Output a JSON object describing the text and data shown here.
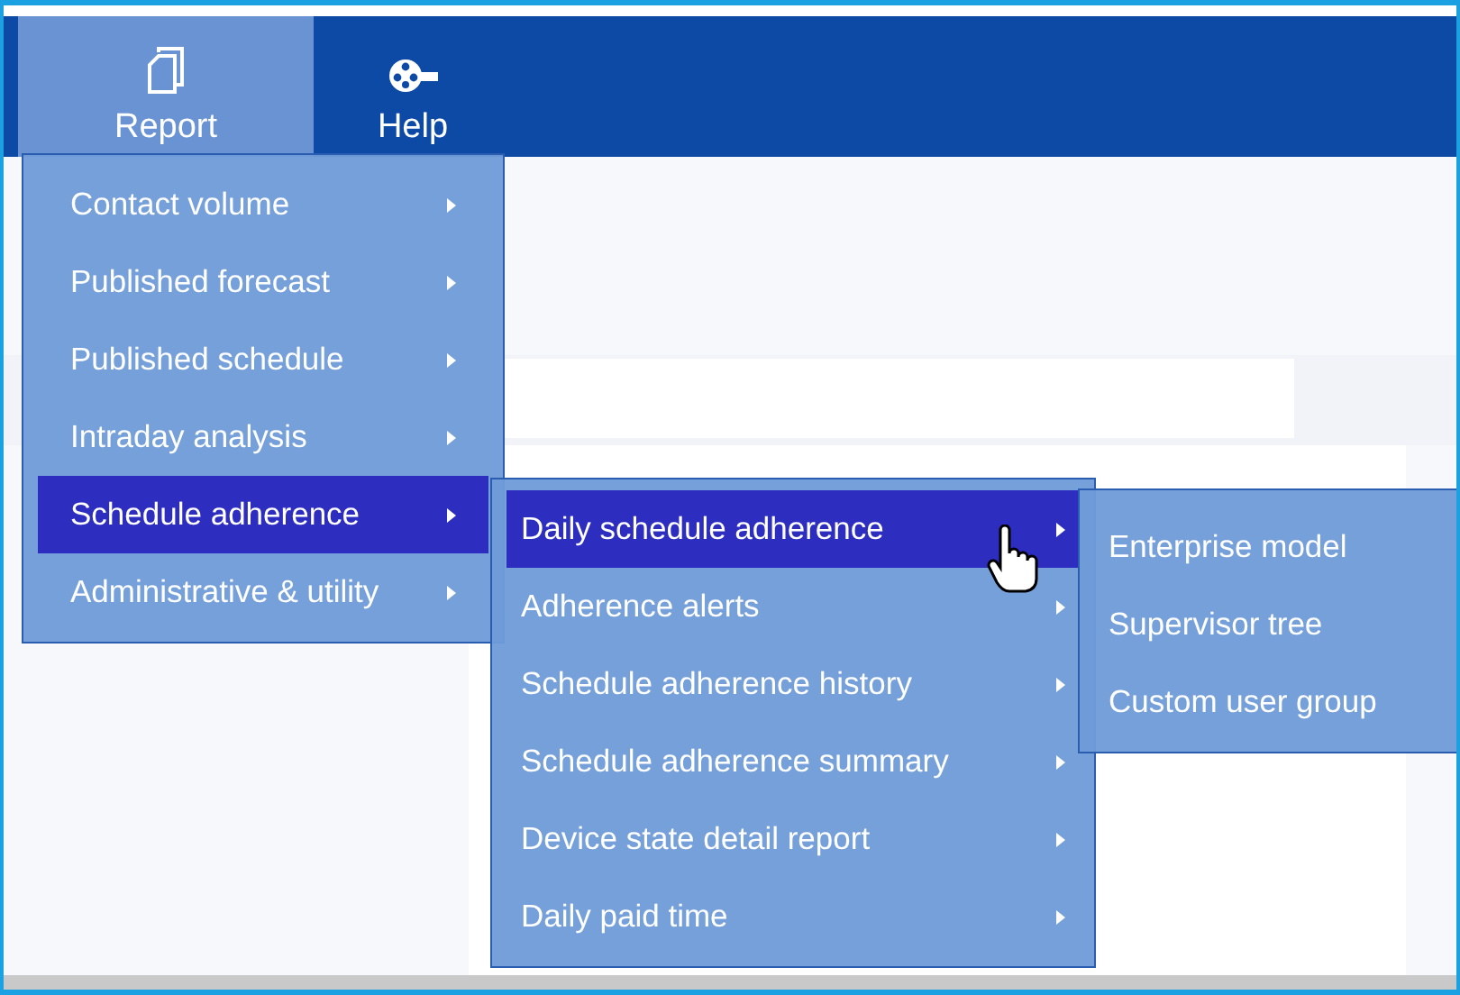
{
  "toolbar": {
    "buttons": [
      {
        "label": "Report",
        "kind": "pages",
        "selected": true
      },
      {
        "label": "Help",
        "kind": "reel",
        "selected": false
      }
    ]
  },
  "menus": [
    {
      "items": [
        {
          "label": "Contact volume",
          "submenu": true,
          "selected": false
        },
        {
          "label": "Published forecast",
          "submenu": true,
          "selected": false
        },
        {
          "label": "Published schedule",
          "submenu": true,
          "selected": false
        },
        {
          "label": "Intraday analysis",
          "submenu": true,
          "selected": false
        },
        {
          "label": "Schedule adherence",
          "submenu": true,
          "selected": true
        },
        {
          "label": "Administrative & utility",
          "submenu": true,
          "selected": false
        }
      ]
    },
    {
      "items": [
        {
          "label": "Daily schedule adherence",
          "submenu": true,
          "selected": true
        },
        {
          "label": "Adherence alerts",
          "submenu": true,
          "selected": false
        },
        {
          "label": "Schedule adherence history",
          "submenu": true,
          "selected": false
        },
        {
          "label": "Schedule adherence summary",
          "submenu": true,
          "selected": false
        },
        {
          "label": "Device state detail report",
          "submenu": true,
          "selected": false
        },
        {
          "label": "Daily paid time",
          "submenu": true,
          "selected": false
        }
      ]
    },
    {
      "items": [
        {
          "label": "Enterprise model",
          "submenu": false,
          "selected": false
        },
        {
          "label": "Supervisor tree",
          "submenu": false,
          "selected": false
        },
        {
          "label": "Custom user group",
          "submenu": false,
          "selected": false
        }
      ]
    }
  ]
}
